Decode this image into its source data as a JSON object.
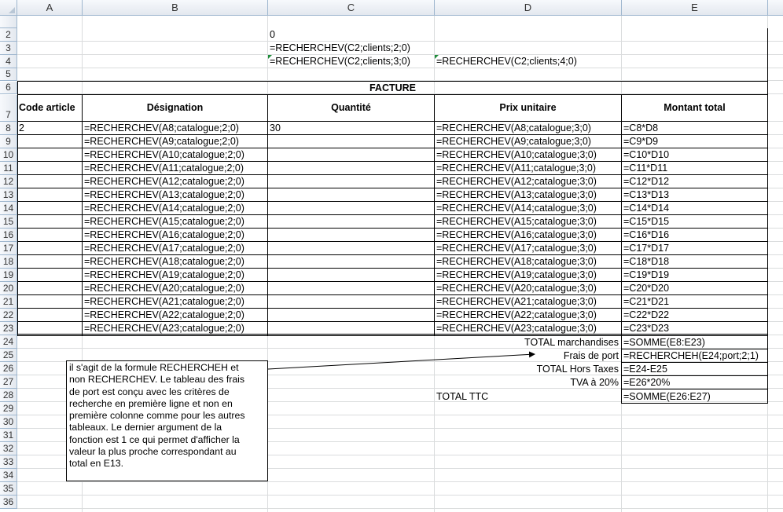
{
  "columns": [
    "A",
    "B",
    "C",
    "D",
    "E"
  ],
  "rows": [
    "2",
    "3",
    "4",
    "5",
    "6",
    "7",
    "8",
    "9",
    "10",
    "11",
    "12",
    "13",
    "14",
    "15",
    "16",
    "17",
    "18",
    "19",
    "20",
    "21",
    "22",
    "23",
    "24",
    "25",
    "26",
    "27",
    "28",
    "29",
    "30",
    "31",
    "32",
    "33",
    "34",
    "35",
    "36"
  ],
  "top_cells": {
    "c2": "0",
    "c3": "=RECHERCHEV(C2;clients;2;0)",
    "c4": "=RECHERCHEV(C2;clients;3;0)",
    "d4": "=RECHERCHEV(C2;clients;4;0)"
  },
  "invoice": {
    "title": "FACTURE",
    "headers": [
      "Code article",
      "Désignation",
      "Quantité",
      "Prix unitaire",
      "Montant total"
    ],
    "rows": [
      {
        "a": "2",
        "b": "=RECHERCHEV(A8;catalogue;2;0)",
        "c": "30",
        "d": "=RECHERCHEV(A8;catalogue;3;0)",
        "e": "=C8*D8"
      },
      {
        "a": "",
        "b": "=RECHERCHEV(A9;catalogue;2;0)",
        "c": "",
        "d": "=RECHERCHEV(A9;catalogue;3;0)",
        "e": "=C9*D9"
      },
      {
        "a": "",
        "b": "=RECHERCHEV(A10;catalogue;2;0)",
        "c": "",
        "d": "=RECHERCHEV(A10;catalogue;3;0)",
        "e": "=C10*D10"
      },
      {
        "a": "",
        "b": "=RECHERCHEV(A11;catalogue;2;0)",
        "c": "",
        "d": "=RECHERCHEV(A11;catalogue;3;0)",
        "e": "=C11*D11"
      },
      {
        "a": "",
        "b": "=RECHERCHEV(A12;catalogue;2;0)",
        "c": "",
        "d": "=RECHERCHEV(A12;catalogue;3;0)",
        "e": "=C12*D12"
      },
      {
        "a": "",
        "b": "=RECHERCHEV(A13;catalogue;2;0)",
        "c": "",
        "d": "=RECHERCHEV(A13;catalogue;3;0)",
        "e": "=C13*D13"
      },
      {
        "a": "",
        "b": "=RECHERCHEV(A14;catalogue;2;0)",
        "c": "",
        "d": "=RECHERCHEV(A14;catalogue;3;0)",
        "e": "=C14*D14"
      },
      {
        "a": "",
        "b": "=RECHERCHEV(A15;catalogue;2;0)",
        "c": "",
        "d": "=RECHERCHEV(A15;catalogue;3;0)",
        "e": "=C15*D15"
      },
      {
        "a": "",
        "b": "=RECHERCHEV(A16;catalogue;2;0)",
        "c": "",
        "d": "=RECHERCHEV(A16;catalogue;3;0)",
        "e": "=C16*D16"
      },
      {
        "a": "",
        "b": "=RECHERCHEV(A17;catalogue;2;0)",
        "c": "",
        "d": "=RECHERCHEV(A17;catalogue;3;0)",
        "e": "=C17*D17"
      },
      {
        "a": "",
        "b": "=RECHERCHEV(A18;catalogue;2;0)",
        "c": "",
        "d": "=RECHERCHEV(A18;catalogue;3;0)",
        "e": "=C18*D18"
      },
      {
        "a": "",
        "b": "=RECHERCHEV(A19;catalogue;2;0)",
        "c": "",
        "d": "=RECHERCHEV(A19;catalogue;3;0)",
        "e": "=C19*D19"
      },
      {
        "a": "",
        "b": "=RECHERCHEV(A20;catalogue;2;0)",
        "c": "",
        "d": "=RECHERCHEV(A20;catalogue;3;0)",
        "e": "=C20*D20"
      },
      {
        "a": "",
        "b": "=RECHERCHEV(A21;catalogue;2;0)",
        "c": "",
        "d": "=RECHERCHEV(A21;catalogue;3;0)",
        "e": "=C21*D21"
      },
      {
        "a": "",
        "b": "=RECHERCHEV(A22;catalogue;2;0)",
        "c": "",
        "d": "=RECHERCHEV(A22;catalogue;3;0)",
        "e": "=C22*D22"
      },
      {
        "a": "",
        "b": "=RECHERCHEV(A23;catalogue;2;0)",
        "c": "",
        "d": "=RECHERCHEV(A23;catalogue;3;0)",
        "e": "=C23*D23"
      }
    ]
  },
  "totals": {
    "marchandises_label": "TOTAL marchandises",
    "marchandises_formula": "=SOMME(E8:E23)",
    "port_label": "Frais de port",
    "port_formula": "=RECHERCHEH(E24;port;2;1)",
    "ht_label": "TOTAL Hors Taxes",
    "ht_formula": "=E24-E25",
    "tva_label": "TVA à 20%",
    "tva_formula": "=E26*20%",
    "ttc_label": "TOTAL TTC",
    "ttc_formula": "=SOMME(E26:E27)"
  },
  "note": {
    "lines": [
      "il s'agit de la formule RECHERCHEH  et",
      "non RECHERCHEV.  Le tableau des frais",
      "de port est conçu avec  les critères de",
      "recherche  en  première  ligne  et non en",
      "première  colonne  comme pour  les autres",
      "tableaux. Le dernier  argument  de la",
      "fonction est 1 ce qui permet d'afficher  la",
      "valeur  la plus proche correspondant  au",
      "total en E13."
    ]
  },
  "colors": {
    "header_border": "#9eb6ce",
    "gridline": "#dadcdd",
    "error_triangle": "#1e8c3a"
  }
}
